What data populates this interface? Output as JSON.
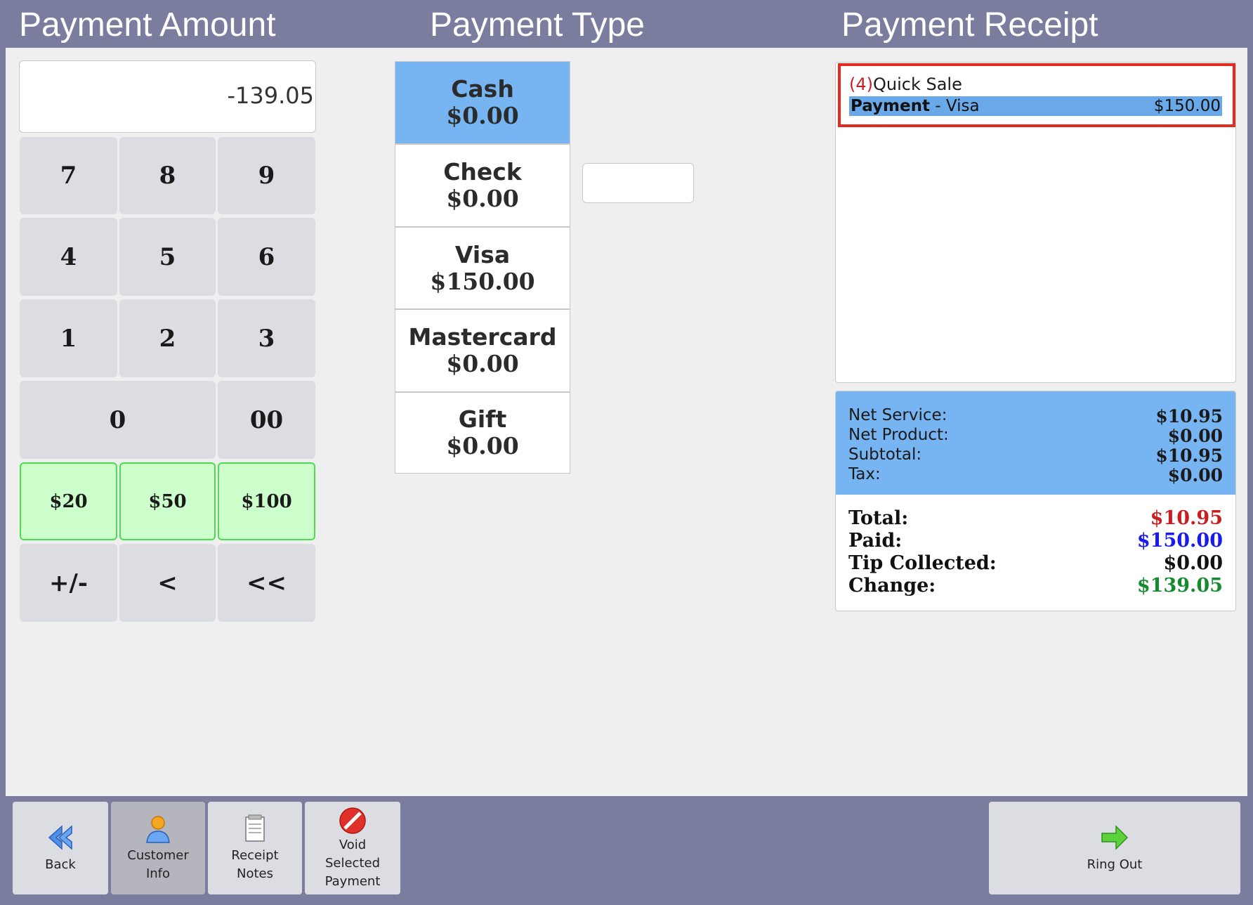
{
  "headers": {
    "payment_amount": "Payment Amount",
    "payment_type": "Payment Type",
    "payment_receipt": "Payment Receipt"
  },
  "amount_display": "-139.05",
  "keypad": {
    "k7": "7",
    "k8": "8",
    "k9": "9",
    "k4": "4",
    "k5": "5",
    "k6": "6",
    "k1": "1",
    "k2": "2",
    "k3": "3",
    "k0": "0",
    "k00": "00",
    "c20": "$20",
    "c50": "$50",
    "c100": "$100",
    "sign": "+/-",
    "back": "<",
    "clear": "<<"
  },
  "payment_types": [
    {
      "name": "Cash",
      "amount": "$0.00"
    },
    {
      "name": "Check",
      "amount": "$0.00"
    },
    {
      "name": "Visa",
      "amount": "$150.00"
    },
    {
      "name": "Mastercard",
      "amount": "$0.00"
    },
    {
      "name": "Gift",
      "amount": "$0.00"
    }
  ],
  "receipt": {
    "item_number": "(4)",
    "item_name": "Quick Sale",
    "payment_label": "Payment",
    "payment_method": " - Visa",
    "payment_amount": "$150.00"
  },
  "totals": {
    "net_service_label": "Net Service:",
    "net_service": "$10.95",
    "net_product_label": "Net Product:",
    "net_product": "$0.00",
    "subtotal_label": "Subtotal:",
    "subtotal": "$10.95",
    "tax_label": "Tax:",
    "tax": "$0.00",
    "total_label": "Total:",
    "total": "$10.95",
    "paid_label": "Paid:",
    "paid": "$150.00",
    "tip_label": "Tip Collected:",
    "tip": "$0.00",
    "change_label": "Change:",
    "change": "$139.05"
  },
  "colors": {
    "total": "#c81e1e",
    "paid": "#1a1aee",
    "change": "#158a2e",
    "highlight_border": "#e32b1f",
    "header_bar": "#7b7d9f",
    "selected_type": "#76b4f2"
  },
  "toolbar": {
    "back": "Back",
    "customer_info_1": "Customer",
    "customer_info_2": "Info",
    "receipt_notes_1": "Receipt",
    "receipt_notes_2": "Notes",
    "void_1": "Void",
    "void_2": "Selected",
    "void_3": "Payment",
    "ring_out": "Ring Out"
  }
}
